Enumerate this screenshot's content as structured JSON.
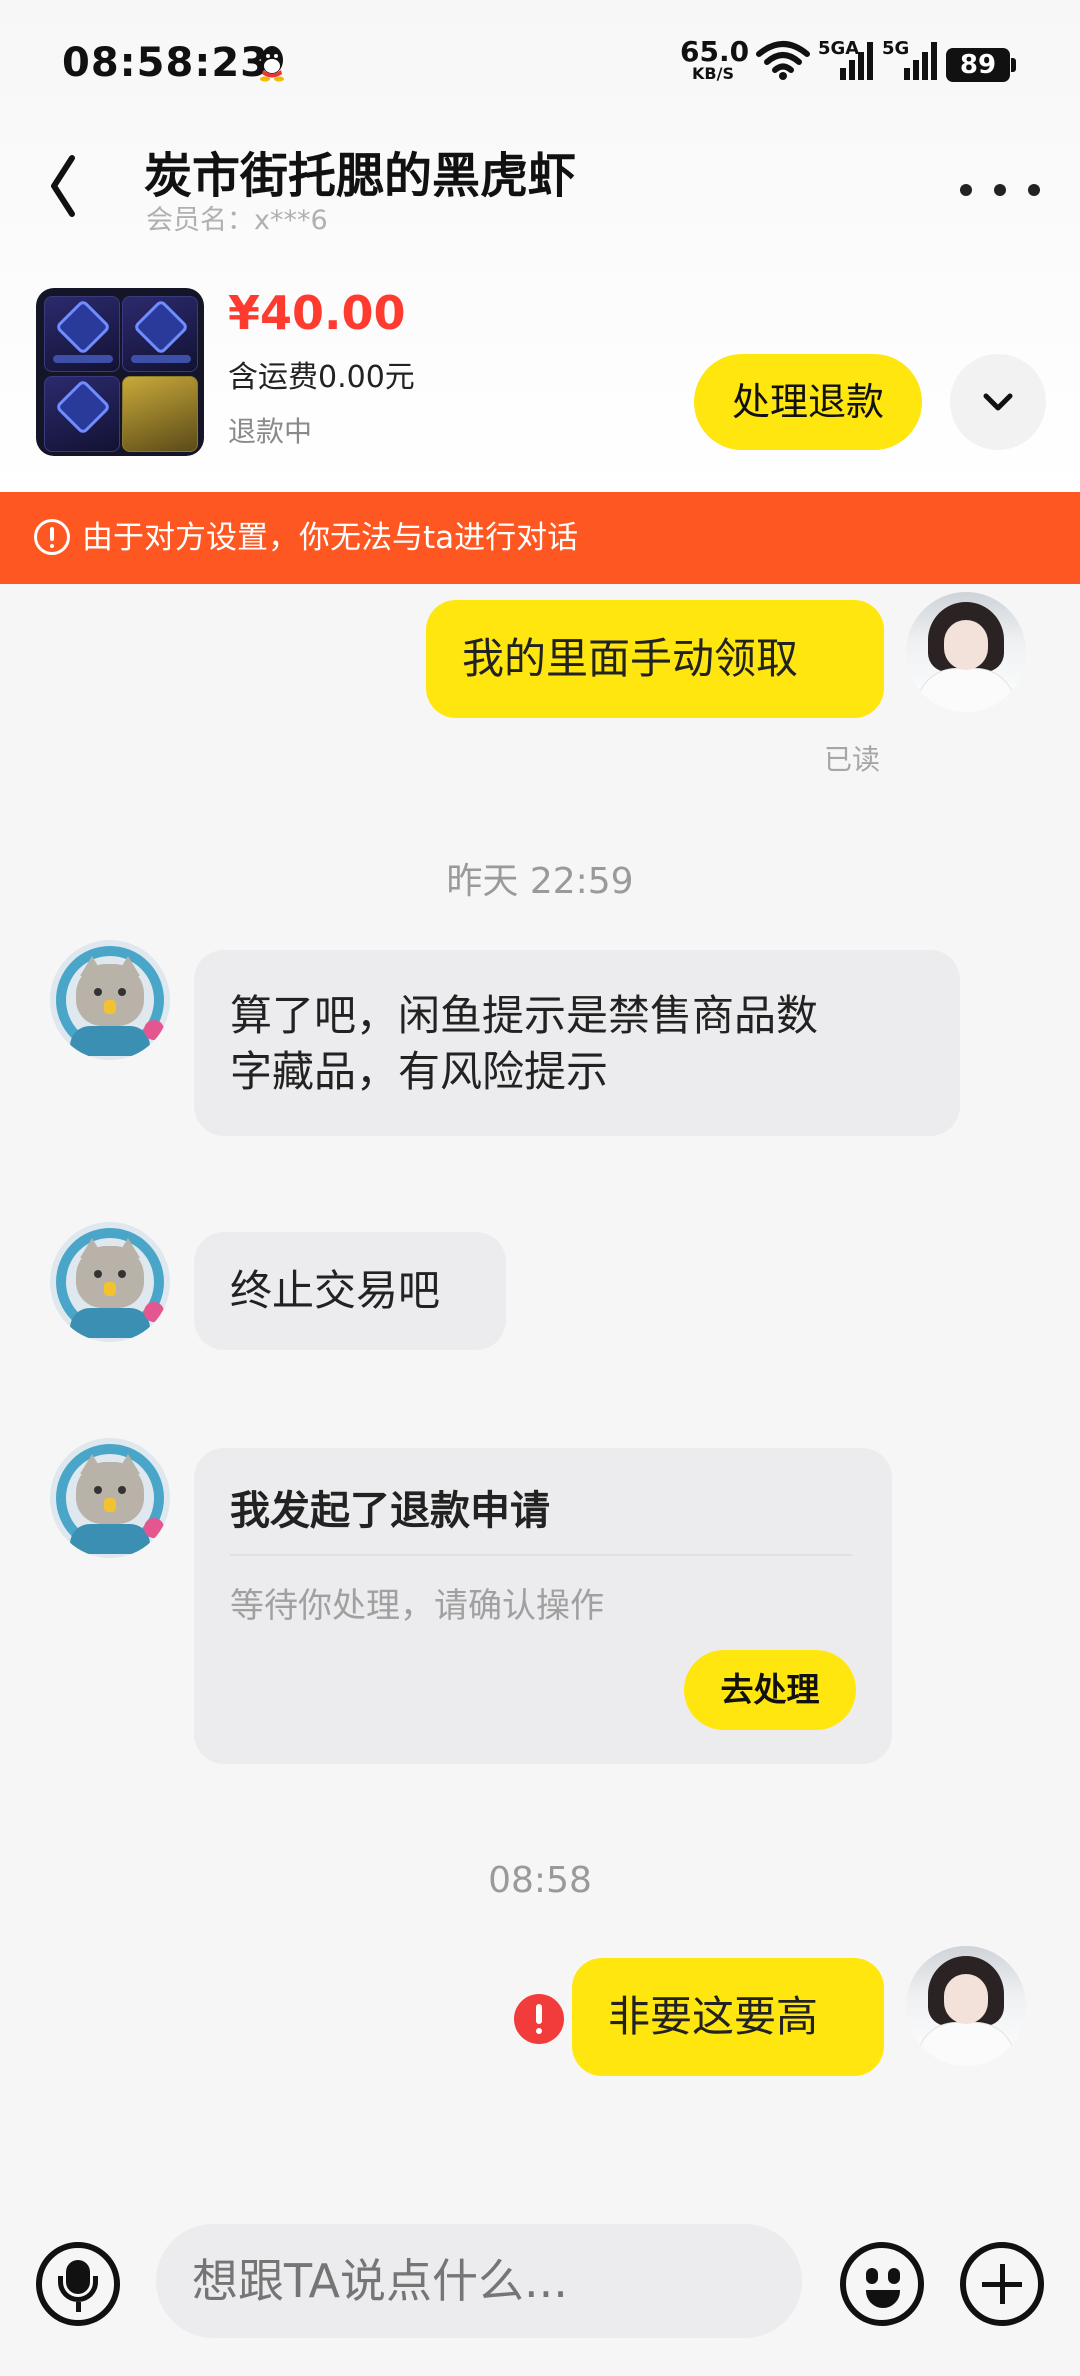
{
  "status_bar": {
    "time": "08:58:23",
    "net_speed": "65.0",
    "net_unit": "KB/S",
    "sim1": "5GA",
    "sim2": "5G",
    "battery": "89"
  },
  "header": {
    "title": "炭市街托腮的黑虎虾",
    "subtitle": "会员名：x***6"
  },
  "product": {
    "price": "¥40.00",
    "shipping": "含运费0.00元",
    "status": "退款中",
    "refund_button": "处理退款"
  },
  "banner": {
    "text": "由于对方设置，你无法与ta进行对话",
    "color": "#ff5722"
  },
  "messages": {
    "m1": {
      "text": "我的里面手动领取",
      "read": "已读"
    },
    "ts1": "昨天 22:59",
    "m2": {
      "line1": "算了吧，闲鱼提示是禁售商品数",
      "line2": "字藏品，有风险提示"
    },
    "m3": {
      "text": "终止交易吧"
    },
    "card": {
      "title": "我发起了退款申请",
      "desc": "等待你处理，请确认操作",
      "button": "去处理"
    },
    "ts2": "08:58",
    "m4": {
      "text": "非要这要高"
    }
  },
  "input_bar": {
    "placeholder": "想跟TA说点什么..."
  },
  "colors": {
    "accent": "#ffe60f",
    "price": "#ff3b30",
    "error": "#f23b3b"
  }
}
